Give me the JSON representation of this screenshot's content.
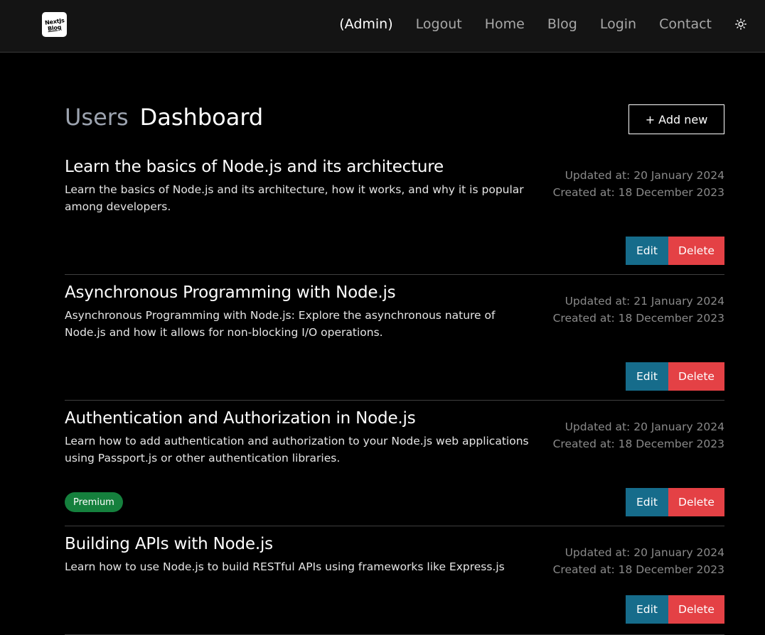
{
  "header": {
    "logo_line1": "NextJs",
    "logo_line2": "Blog",
    "nav": {
      "admin": "(Admin)",
      "logout": "Logout",
      "home": "Home",
      "blog": "Blog",
      "login": "Login",
      "contact": "Contact"
    },
    "theme_icon": "sun-icon"
  },
  "page": {
    "title_prefix": "Users",
    "title_main": "Dashboard",
    "add_new_label": "+ Add new"
  },
  "posts": [
    {
      "title": "Learn the basics of Node.js and its architecture",
      "description": "Learn the basics of Node.js and its architecture, how it works, and why it is popular among developers.",
      "updated": "Updated at: 20 January 2024",
      "created": "Created at: 18 December 2023",
      "edit_label": "Edit",
      "delete_label": "Delete"
    },
    {
      "title": "Asynchronous Programming with Node.js",
      "description": "Asynchronous Programming with Node.js: Explore the asynchronous nature of Node.js and how it allows for non-blocking I/O operations.",
      "updated": "Updated at: 21 January 2024",
      "created": "Created at: 18 December 2023",
      "edit_label": "Edit",
      "delete_label": "Delete"
    },
    {
      "title": "Authentication and Authorization in Node.js",
      "description": "Learn how to add authentication and authorization to your Node.js web applications using Passport.js or other authentication libraries.",
      "updated": "Updated at: 20 January 2024",
      "created": "Created at: 18 December 2023",
      "badge": "Premium",
      "edit_label": "Edit",
      "delete_label": "Delete"
    },
    {
      "title": "Building APIs with Node.js",
      "description": "Learn how to use Node.js to build RESTful APIs using frameworks like Express.js",
      "updated": "Updated at: 20 January 2024",
      "created": "Created at: 18 December 2023",
      "edit_label": "Edit",
      "delete_label": "Delete"
    }
  ],
  "colors": {
    "background": "#000000",
    "header_bg": "#141414",
    "edit": "#166c8b",
    "delete": "#e44145",
    "premium": "#15803d"
  }
}
